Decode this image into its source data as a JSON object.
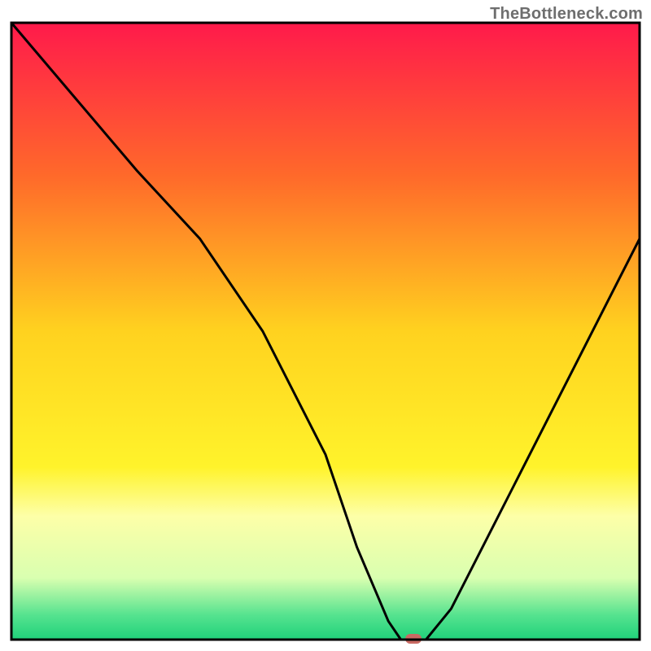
{
  "watermark": "TheBottleneck.com",
  "chart_data": {
    "type": "line",
    "title": "",
    "xlabel": "",
    "ylabel": "",
    "xlim": [
      0,
      100
    ],
    "ylim": [
      0,
      100
    ],
    "x": [
      0,
      10,
      20,
      30,
      40,
      50,
      55,
      60,
      62,
      66,
      70,
      80,
      90,
      100
    ],
    "values": [
      100,
      88,
      76,
      65,
      50,
      30,
      15,
      3,
      0,
      0,
      5,
      25,
      45,
      65
    ],
    "optimal_marker": {
      "x": 64,
      "y": 0
    },
    "gradient_stops": [
      {
        "offset": 0.0,
        "color": "#ff1a4b"
      },
      {
        "offset": 0.25,
        "color": "#ff6a2a"
      },
      {
        "offset": 0.5,
        "color": "#ffd21f"
      },
      {
        "offset": 0.72,
        "color": "#fff32b"
      },
      {
        "offset": 0.8,
        "color": "#fdffa8"
      },
      {
        "offset": 0.9,
        "color": "#d9ffb0"
      },
      {
        "offset": 0.96,
        "color": "#56e38f"
      },
      {
        "offset": 1.0,
        "color": "#1fd17a"
      }
    ],
    "frame_color": "#000000",
    "line_color": "#000000",
    "marker_color": "#c96a63"
  }
}
